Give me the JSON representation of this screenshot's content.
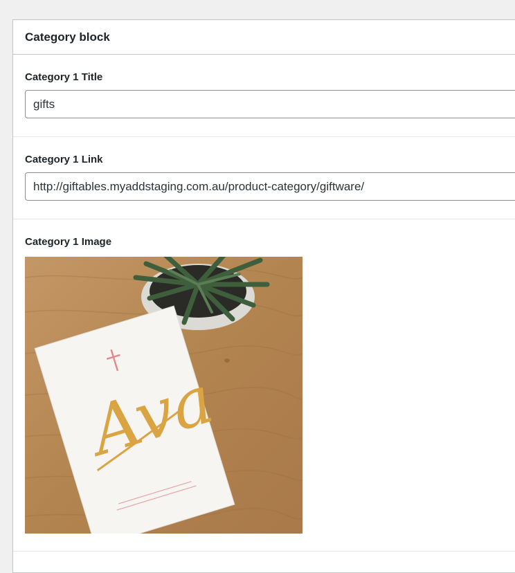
{
  "panel": {
    "title": "Category block"
  },
  "fields": {
    "title": {
      "label": "Category 1 Title",
      "value": "gifts"
    },
    "link": {
      "label": "Category 1 Link",
      "value": "http://giftables.myaddstaging.com.au/product-category/giftware/"
    },
    "image": {
      "label": "Category 1 Image",
      "card_text": "Ava",
      "alt": "Category 1 Image"
    }
  },
  "colors": {
    "wood": "#b88a55",
    "card": "#f7f5f2",
    "gold": "#d9a441",
    "cross": "#e08a8e",
    "plant": "#3e5e3c",
    "pot": "#e8e6e2"
  }
}
